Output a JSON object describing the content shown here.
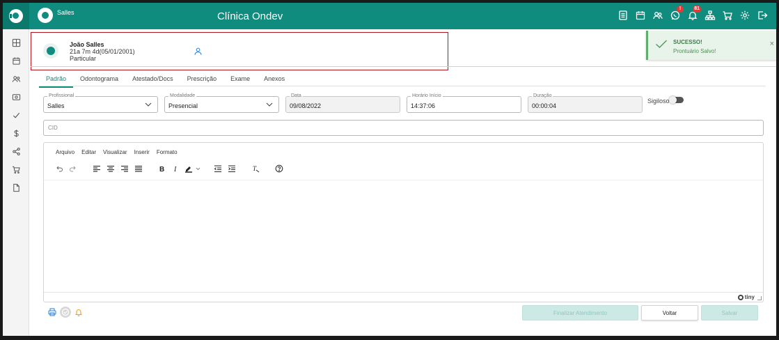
{
  "header": {
    "user_name": "Salles",
    "clinic_title": "Clínica Ondev",
    "icons": [
      {
        "name": "records-icon",
        "badge": ""
      },
      {
        "name": "calendar-icon",
        "badge": ""
      },
      {
        "name": "users-icon",
        "badge": ""
      },
      {
        "name": "whatsapp-icon",
        "badge": "!"
      },
      {
        "name": "bell-icon",
        "badge": "81"
      },
      {
        "name": "org-chart-icon",
        "badge": ""
      },
      {
        "name": "cart-icon",
        "badge": ""
      },
      {
        "name": "settings-icon",
        "badge": ""
      },
      {
        "name": "logout-icon",
        "badge": ""
      }
    ]
  },
  "sidebar": {
    "items": [
      "dashboard-icon",
      "calendar-icon",
      "patients-icon",
      "cash-icon",
      "check-icon",
      "dollar-icon",
      "share-icon",
      "cart-icon",
      "document-icon"
    ]
  },
  "patient": {
    "name": "João Salles",
    "age": "21a 7m 4d(05/01/2001)",
    "plan": "Particular"
  },
  "toast": {
    "title": "SUCESSO!",
    "message": "Prontuário Salvo!",
    "close": "×"
  },
  "tabs": [
    "Padrão",
    "Odontograma",
    "Atestado/Docs",
    "Prescrição",
    "Exame",
    "Anexos"
  ],
  "form": {
    "profissional": {
      "label": "Profissional",
      "value": "Salles"
    },
    "modalidade": {
      "label": "Modalidade",
      "value": "Presencial"
    },
    "data": {
      "label": "Data",
      "value": "09/08/2022"
    },
    "horario": {
      "label": "Horário Início",
      "value": "14:37:06"
    },
    "duracao": {
      "label": "Duração",
      "value": "00:00:04"
    },
    "sigiloso": {
      "label": "Sigiloso",
      "on": false
    },
    "cid": {
      "placeholder": "CID"
    }
  },
  "editor": {
    "menu": [
      "Arquivo",
      "Editar",
      "Visualizar",
      "Inserir",
      "Formato"
    ],
    "brand": "tiny"
  },
  "footer": {
    "finalizar": "Finalizar Atendimento",
    "voltar": "Voltar",
    "salvar": "Salvar"
  },
  "colors": {
    "primary": "#0f8c7e",
    "highlight_border": "#b0161c",
    "toast_bg": "#e8f3ea"
  }
}
